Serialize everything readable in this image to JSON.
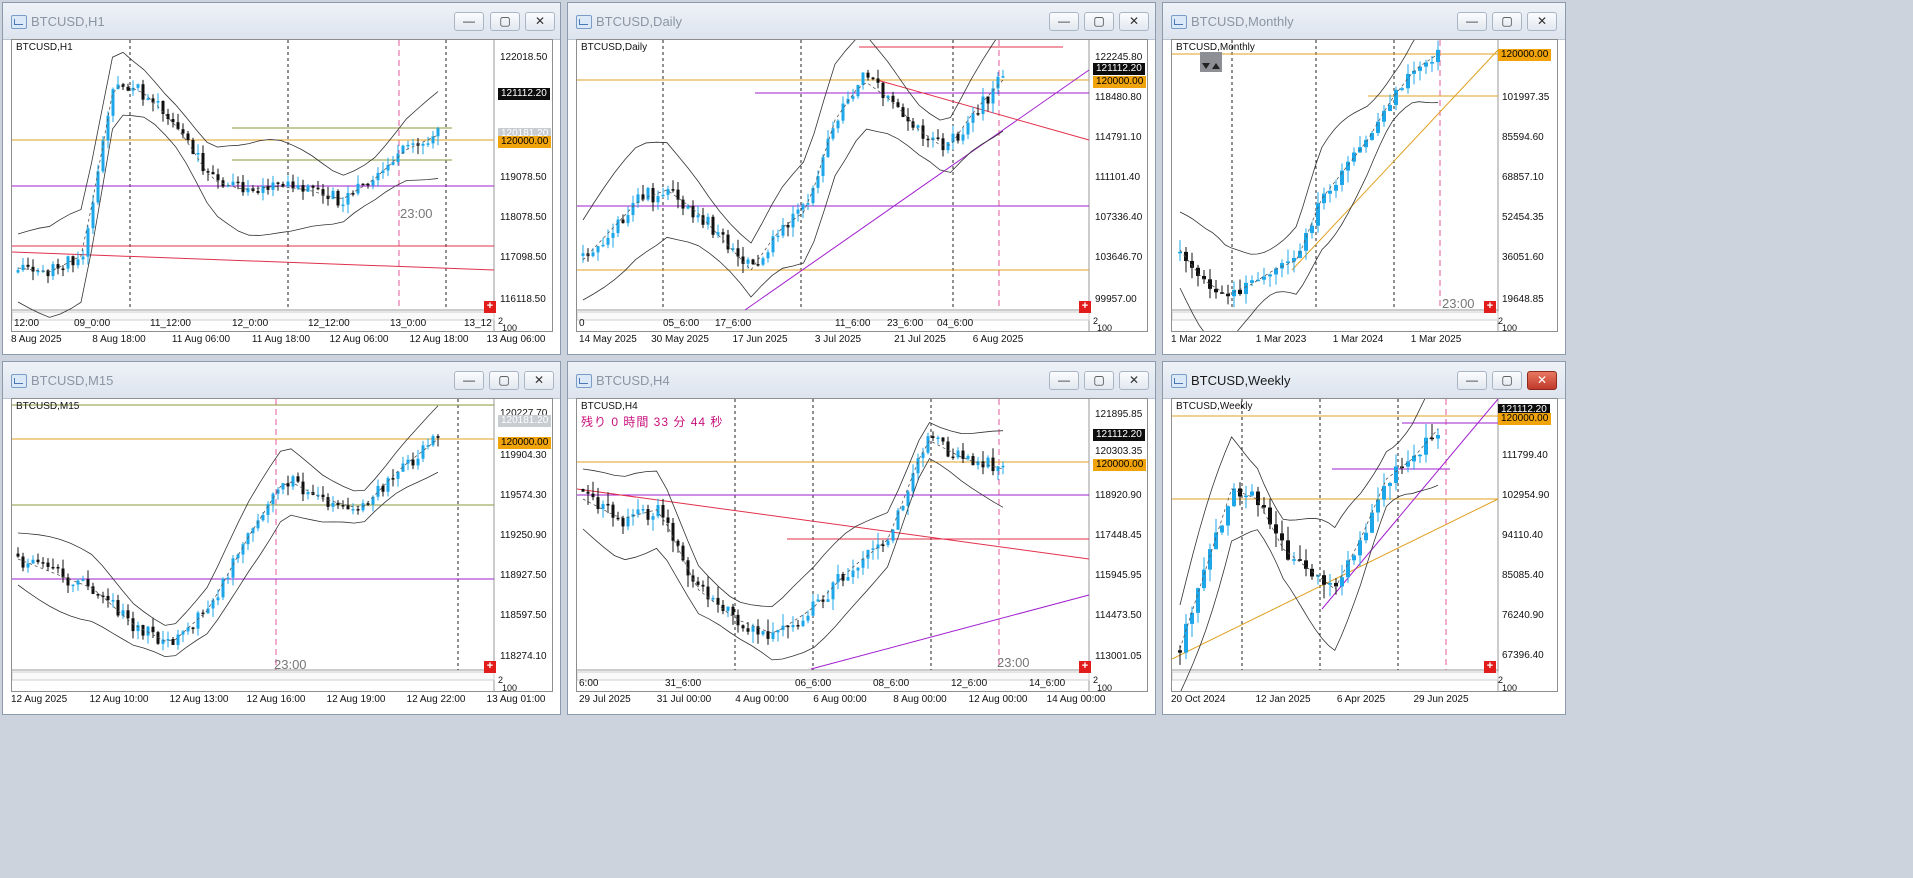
{
  "windows": [
    {
      "id": "h1",
      "title": "BTCUSD,H1",
      "active": false,
      "symbol_label": "BTCUSD,H1",
      "bid_price": "121112.20",
      "level_price": "120000.00",
      "silver_price": "120181.20",
      "price_labels": [
        "122018.50",
        "121112.20",
        "120181.20",
        "120000.00",
        "119078.50",
        "118078.50",
        "117098.50",
        "116118.50"
      ],
      "x_labels": [
        "8 Aug 2025",
        "8 Aug 18:00",
        "11 Aug 06:00",
        "11 Aug 18:00",
        "12 Aug 06:00",
        "12 Aug 18:00",
        "13 Aug 06:00"
      ],
      "inner_time_labels": [
        "12:00",
        "09_0:00",
        "11_12:00",
        "12_0:00",
        "12_12:00",
        "13_0:00",
        "13_12"
      ],
      "watermark": "23:00",
      "scale_marks": [
        "2",
        "100"
      ]
    },
    {
      "id": "daily",
      "title": "BTCUSD,Daily",
      "active": false,
      "symbol_label": "BTCUSD,Daily",
      "bid_price": "121112.20",
      "level_price": "120000.00",
      "price_labels": [
        "122245.80",
        "121112.20",
        "120000.00",
        "118480.80",
        "114791.10",
        "111101.40",
        "107336.40",
        "103646.70",
        "99957.00"
      ],
      "x_labels": [
        "14 May 2025",
        "30 May 2025",
        "17 Jun 2025",
        "3 Jul 2025",
        "21 Jul 2025",
        "6 Aug 2025"
      ],
      "inner_time_labels": [
        "0",
        "05_6:00",
        "17_6:00",
        "11_6:00",
        "23_6:00",
        "04_6:00"
      ],
      "scale_marks": [
        "2",
        "100"
      ]
    },
    {
      "id": "monthly",
      "title": "BTCUSD,Monthly",
      "active": false,
      "symbol_label": "BTCUSD,Monthly",
      "level_price": "120000.00",
      "price_labels": [
        "120000.00",
        "101997.35",
        "85594.60",
        "68857.10",
        "52454.35",
        "36051.60",
        "19648.85"
      ],
      "x_labels": [
        "1 Mar 2022",
        "1 Mar 2023",
        "1 Mar 2024",
        "1 Mar 2025"
      ],
      "watermark": "23:00",
      "scale_marks": [
        "2",
        "100"
      ]
    },
    {
      "id": "m15",
      "title": "BTCUSD,M15",
      "active": false,
      "symbol_label": "BTCUSD,M15",
      "level_price": "120000.00",
      "silver_price": "120181.20",
      "price_labels": [
        "120227.70",
        "120181.20",
        "120000.00",
        "119904.30",
        "119574.30",
        "119250.90",
        "118927.50",
        "118597.50",
        "118274.10"
      ],
      "x_labels": [
        "12 Aug 2025",
        "12 Aug 10:00",
        "12 Aug 13:00",
        "12 Aug 16:00",
        "12 Aug 19:00",
        "12 Aug 22:00",
        "13 Aug 01:00"
      ],
      "watermark": "23:00",
      "scale_marks": [
        "2",
        "100"
      ]
    },
    {
      "id": "h4",
      "title": "BTCUSD,H4",
      "active": false,
      "symbol_label": "BTCUSD,H4",
      "countdown": "残り 0 時間 33 分 44 秒",
      "bid_price": "121112.20",
      "level_price": "120000.00",
      "price_labels": [
        "121895.85",
        "121112.20",
        "120303.35",
        "120000.00",
        "118920.90",
        "117448.45",
        "115945.95",
        "114473.50",
        "113001.05"
      ],
      "x_labels": [
        "29 Jul 2025",
        "31 Jul 00:00",
        "4 Aug 00:00",
        "6 Aug 00:00",
        "8 Aug 00:00",
        "12 Aug 00:00",
        "14 Aug 00:00"
      ],
      "inner_time_labels": [
        "6:00",
        "31_6:00",
        "06_6:00",
        "08_6:00",
        "12_6:00",
        "14_6:00"
      ],
      "watermark": "23:00",
      "scale_marks": [
        "2",
        "100"
      ]
    },
    {
      "id": "weekly",
      "title": "BTCUSD,Weekly",
      "active": true,
      "symbol_label": "BTCUSD,Weekly",
      "bid_price": "121112.20",
      "level_price": "120000.00",
      "price_labels": [
        "121112.20",
        "120000.00",
        "111799.40",
        "102954.90",
        "94110.40",
        "85085.40",
        "76240.90",
        "67396.40"
      ],
      "x_labels": [
        "20 Oct 2024",
        "12 Jan 2025",
        "6 Apr 2025",
        "29 Jun 2025"
      ],
      "scale_marks": [
        "2",
        "100"
      ]
    }
  ],
  "buttons": {
    "minimize": "—",
    "maximize": "▢",
    "close": "✕",
    "add": "+"
  },
  "colors": {
    "up_candle": "#1ea7e8",
    "down_candle": "#111111",
    "gold_level": "#e0a020",
    "magenta_level": "#a21fcf",
    "trend_red": "#e2304a",
    "bid_tag": "#0d0d0d",
    "gold_tag": "#f0a30a",
    "pink_vline": "#e0579b"
  }
}
